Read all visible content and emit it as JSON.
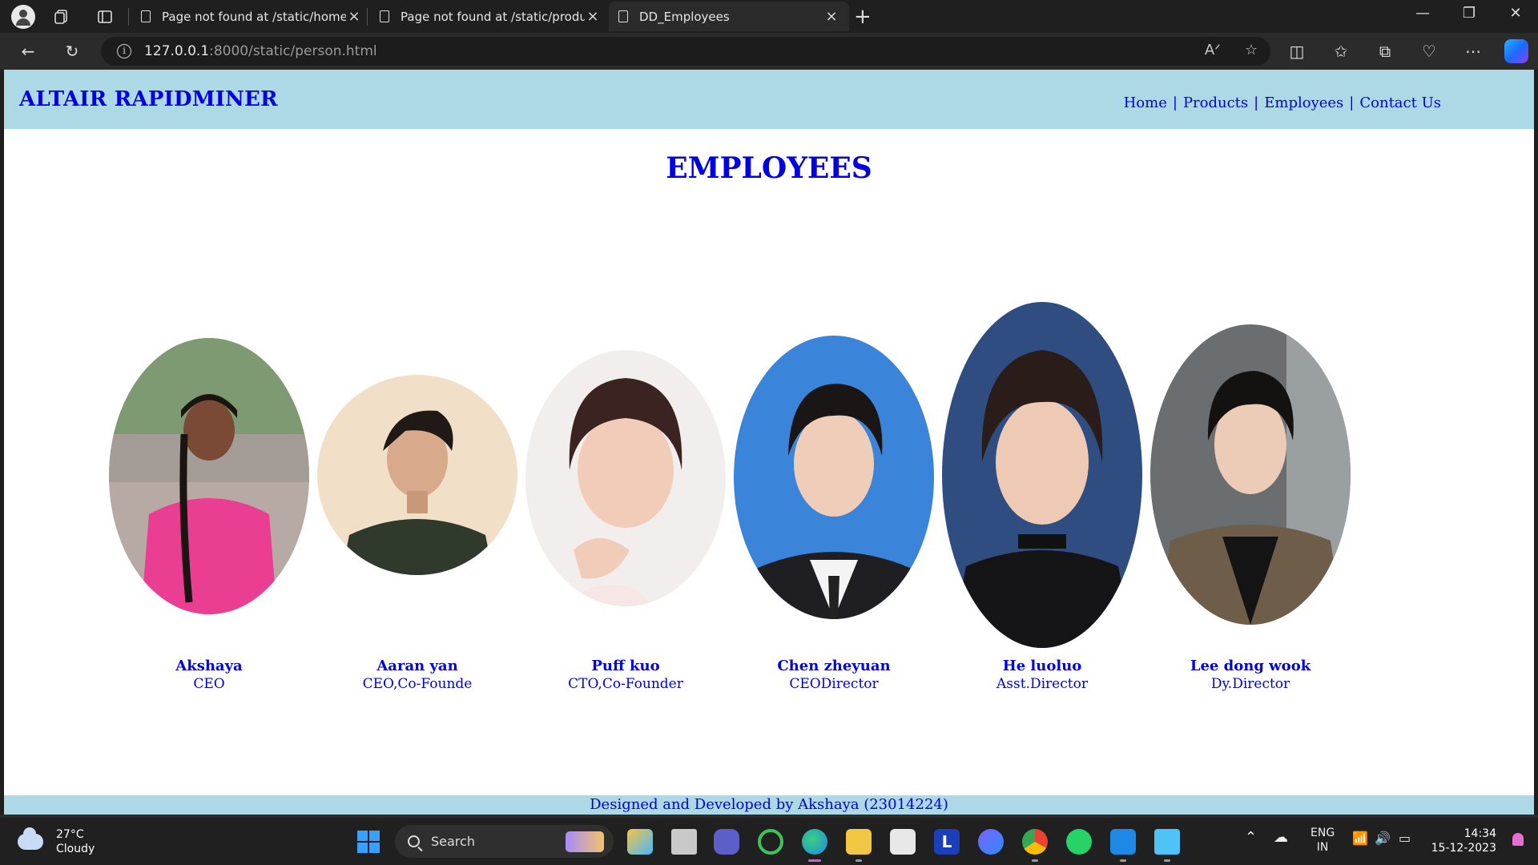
{
  "browser": {
    "tabs": [
      {
        "title": "Page not found at /static/home1",
        "active": false
      },
      {
        "title": "Page not found at /static/produc",
        "active": false
      },
      {
        "title": "DD_Employees",
        "active": true
      }
    ],
    "address": {
      "host": "127.0.0.1",
      "path": ":8000/static/person.html"
    }
  },
  "site": {
    "brand": "ALTAIR RAPIDMINER",
    "nav": [
      {
        "label": "Home"
      },
      {
        "label": "Products"
      },
      {
        "label": "Employees"
      },
      {
        "label": "Contact Us"
      }
    ],
    "nav_separator": "|",
    "heading": "EMPLOYEES",
    "employees": [
      {
        "name": "Akshaya",
        "role": "CEO"
      },
      {
        "name": "Aaran yan",
        "role": "CEO,Co-Founde"
      },
      {
        "name": "Puff kuo",
        "role": "CTO,Co-Founder"
      },
      {
        "name": "Chen zheyuan",
        "role": "CEODirector"
      },
      {
        "name": "He luoluo",
        "role": "Asst.Director"
      },
      {
        "name": "Lee dong wook",
        "role": "Dy.Director"
      }
    ],
    "footer": "Designed and Developed by Akshaya (23014224)"
  },
  "taskbar": {
    "weather": {
      "temp": "27°C",
      "condition": "Cloudy"
    },
    "search_label": "Search",
    "language": {
      "line1": "ENG",
      "line2": "IN"
    },
    "time": "14:34",
    "date": "15-12-2023"
  },
  "colors": {
    "header_bg": "#add8e6",
    "link_blue": "#0000e6",
    "chrome_dark": "#1f1f1f"
  }
}
